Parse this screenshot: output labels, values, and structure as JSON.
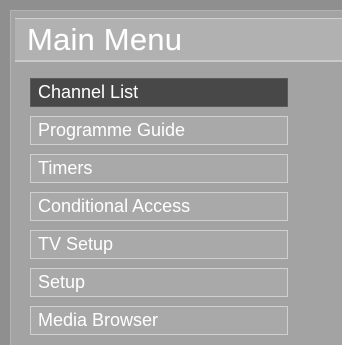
{
  "menu": {
    "title": "Main Menu",
    "items": [
      {
        "label": "Channel List",
        "selected": true
      },
      {
        "label": "Programme Guide",
        "selected": false
      },
      {
        "label": "Timers",
        "selected": false
      },
      {
        "label": "Conditional Access",
        "selected": false
      },
      {
        "label": "TV Setup",
        "selected": false
      },
      {
        "label": "Setup",
        "selected": false
      },
      {
        "label": "Media Browser",
        "selected": false
      }
    ]
  },
  "colors": {
    "background": "#8f8f8f",
    "panel": "#a3a3a3",
    "header": "#b1b1b1",
    "item": "#a9a9a9",
    "item_border": "#d0d0d0",
    "selected_item": "#484848",
    "text": "#ffffff"
  }
}
